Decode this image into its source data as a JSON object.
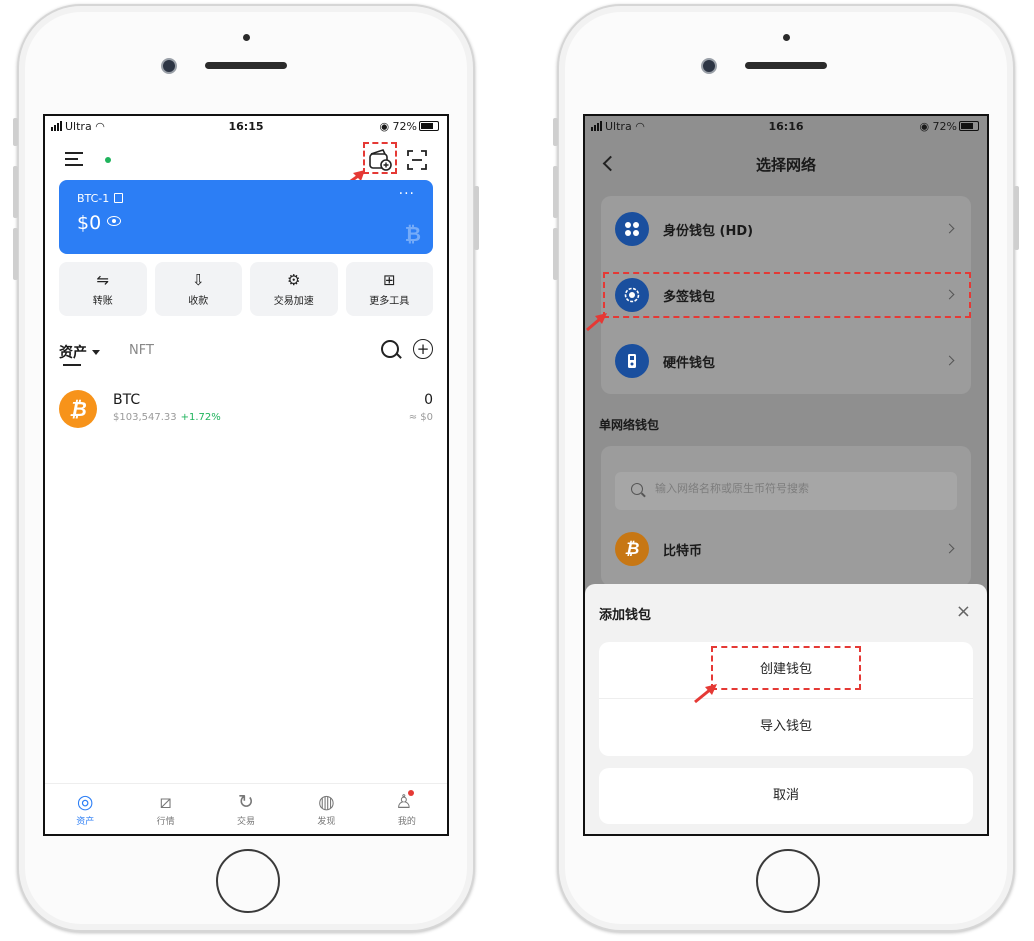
{
  "left_phone": {
    "status": {
      "carrier": "Ultra",
      "time": "16:15",
      "battery": "72%"
    },
    "wallet": {
      "name": "BTC-1",
      "balance": "$0",
      "more": "···",
      "watermark": "₿"
    },
    "actions": [
      {
        "label": "转账",
        "icon": "transfer-icon",
        "glyph": "⇋"
      },
      {
        "label": "收款",
        "icon": "receive-icon",
        "glyph": "⇩"
      },
      {
        "label": "交易加速",
        "icon": "accelerate-icon",
        "glyph": "⚙"
      },
      {
        "label": "更多工具",
        "icon": "grid-icon",
        "glyph": "⊞"
      }
    ],
    "tabs": {
      "assets": "资产",
      "nft": "NFT"
    },
    "asset": {
      "symbol": "BTC",
      "logo": "₿",
      "price": "$103,547.33",
      "change": "+1.72%",
      "quantity": "0",
      "value": "≈ $0"
    },
    "tabbar": [
      {
        "label": "资产",
        "glyph": "◎",
        "icon": "assets-tab-icon",
        "active": true
      },
      {
        "label": "行情",
        "glyph": "⧄",
        "icon": "market-tab-icon",
        "active": false
      },
      {
        "label": "交易",
        "glyph": "↻",
        "icon": "trade-tab-icon",
        "active": false
      },
      {
        "label": "发现",
        "glyph": "◍",
        "icon": "discover-tab-icon",
        "active": false
      },
      {
        "label": "我的",
        "glyph": "♙",
        "icon": "profile-tab-icon",
        "active": false
      }
    ],
    "colors": {
      "accent": "#2c7ef5",
      "positive": "#1fb35c",
      "highlight": "#e53935",
      "btc": "#f7931a"
    }
  },
  "right_phone": {
    "status": {
      "carrier": "Ultra",
      "time": "16:16",
      "battery": "72%"
    },
    "title": "选择网络",
    "wallet_types": [
      {
        "label": "身份钱包 (HD)",
        "icon": "identity-wallet-icon"
      },
      {
        "label": "多签钱包",
        "icon": "multisig-wallet-icon"
      },
      {
        "label": "硬件钱包",
        "icon": "hardware-wallet-icon"
      }
    ],
    "single_network_title": "单网络钱包",
    "search_placeholder": "输入网络名称或原生币符号搜索",
    "networks": [
      {
        "label": "比特币",
        "logo": "₿"
      }
    ],
    "sheet": {
      "title": "添加钱包",
      "create": "创建钱包",
      "import": "导入钱包",
      "cancel": "取消",
      "close": "×"
    }
  }
}
